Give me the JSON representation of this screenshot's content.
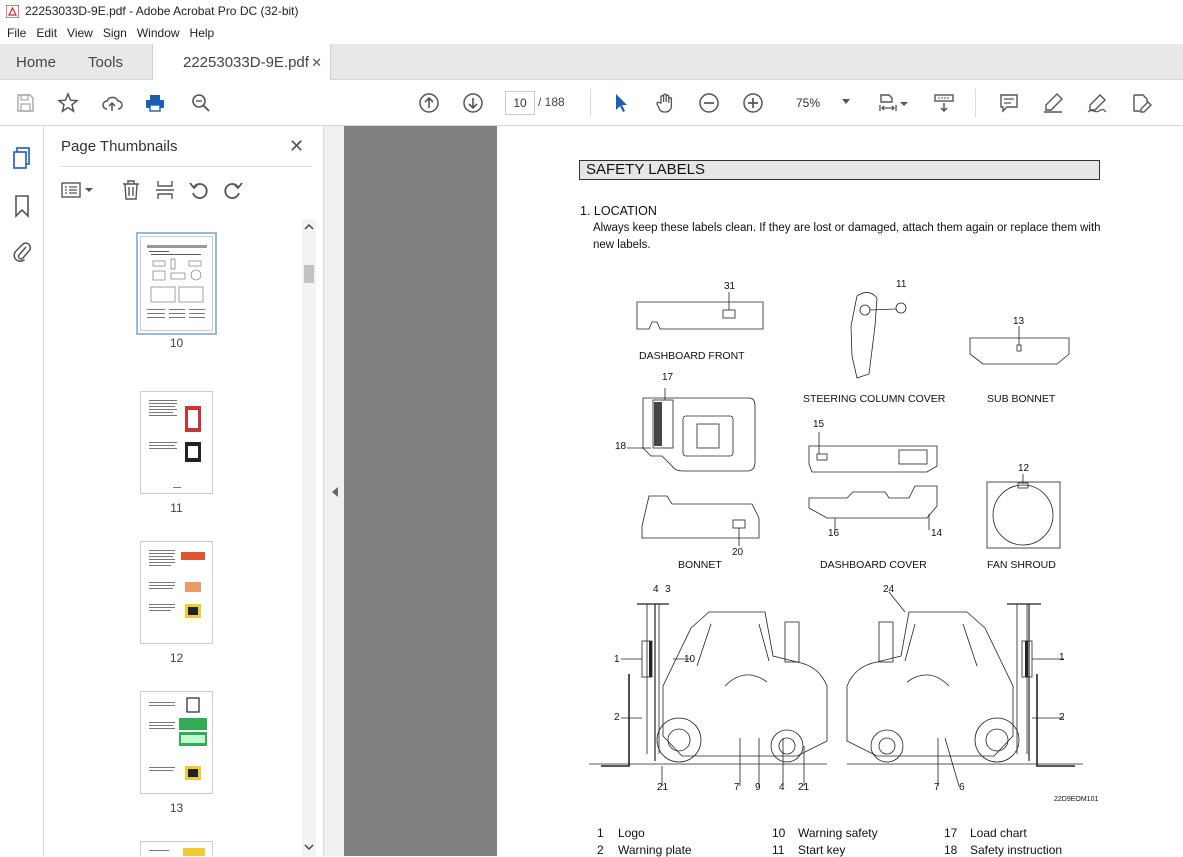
{
  "window": {
    "title": "22253033D-9E.pdf - Adobe Acrobat Pro DC (32-bit)"
  },
  "menu": [
    "File",
    "Edit",
    "View",
    "Sign",
    "Window",
    "Help"
  ],
  "tabs": {
    "home": "Home",
    "tools": "Tools",
    "document": "22253033D-9E.pdf"
  },
  "toolbar": {
    "current_page": "10",
    "total_pages": "/ 188",
    "zoom": "75%"
  },
  "panel": {
    "title": "Page Thumbnails",
    "thumbnails": [
      {
        "label": "10",
        "selected": true
      },
      {
        "label": "11",
        "selected": false
      },
      {
        "label": "12",
        "selected": false
      },
      {
        "label": "13",
        "selected": false
      }
    ]
  },
  "document": {
    "section_title": "SAFETY LABELS",
    "location_heading": "1. LOCATION",
    "intro": "Always keep these labels clean.  If they are lost or damaged, attach them again or replace them with new labels.",
    "captions": {
      "dashboard_front": "DASHBOARD FRONT",
      "steering_column_cover": "STEERING COLUMN COVER",
      "sub_bonnet": "SUB BONNET",
      "bonnet": "BONNET",
      "dashboard_cover": "DASHBOARD COVER",
      "fan_shroud": "FAN SHROUD",
      "figure_code": "22D9EOM101"
    },
    "callouts": {
      "n31": "31",
      "n11": "11",
      "n13": "13",
      "n17": "17",
      "n18": "18",
      "n15": "15",
      "n12": "12",
      "n20": "20",
      "n16": "16",
      "n14": "14",
      "n4a": "4",
      "n3": "3",
      "n24": "24",
      "n1a": "1",
      "n10": "10",
      "n1b": "1",
      "n2a": "2",
      "n2b": "2",
      "n21a": "21",
      "n7a": "7",
      "n9": "9",
      "n4b": "4",
      "n21b": "21",
      "n7b": "7",
      "n6": "6"
    },
    "legend": [
      {
        "num": "1",
        "text": "Logo"
      },
      {
        "num": "10",
        "text": "Warning safety"
      },
      {
        "num": "17",
        "text": "Load chart"
      },
      {
        "num": "2",
        "text": "Warning plate"
      },
      {
        "num": "11",
        "text": "Start key"
      },
      {
        "num": "18",
        "text": "Safety instruction"
      }
    ]
  }
}
